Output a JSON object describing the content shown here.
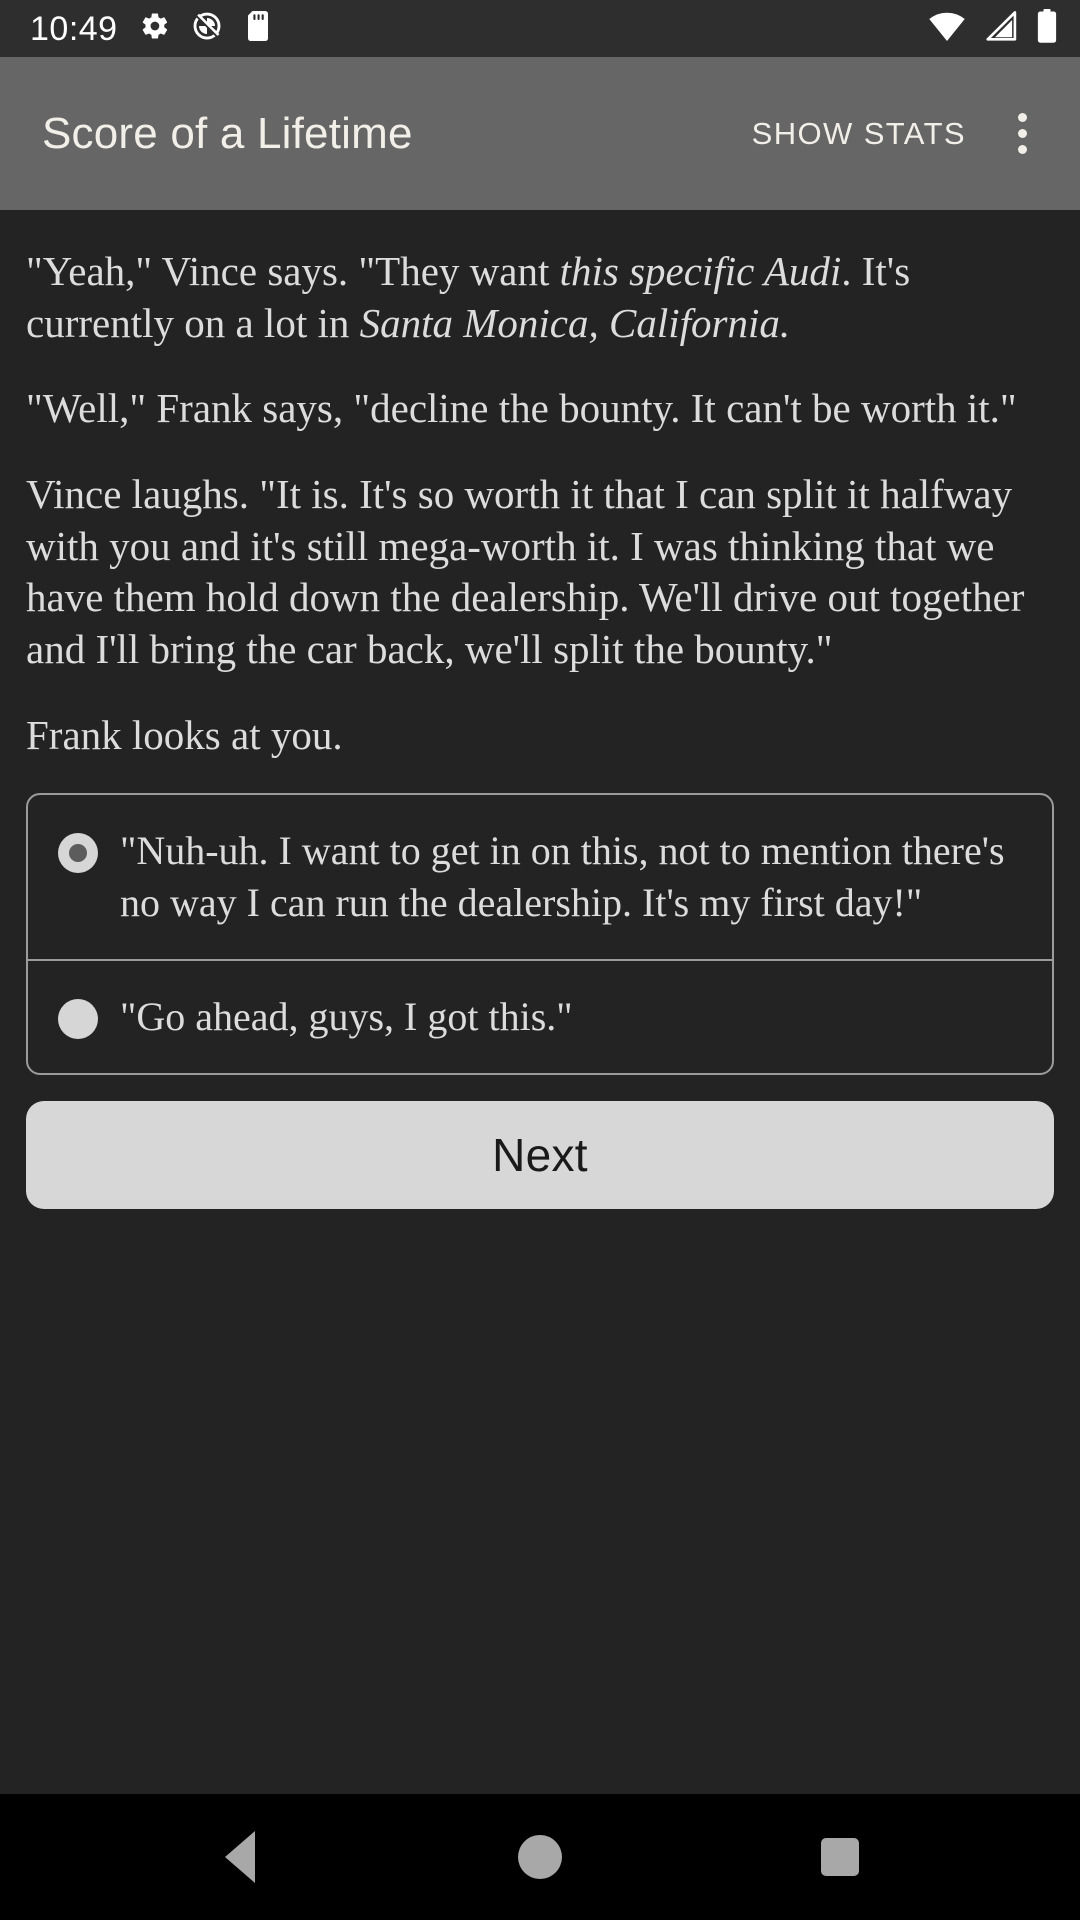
{
  "status_bar": {
    "time": "10:49",
    "left_icons": [
      "gear-icon",
      "do-not-disturb-icon",
      "sd-card-icon"
    ],
    "right_icons": [
      "wifi-icon",
      "cellular-signal-icon",
      "battery-icon"
    ],
    "background_color": "#2e2e2e",
    "foreground_color": "#ffffff"
  },
  "app_bar": {
    "title": "Score of a Lifetime",
    "show_stats_label": "SHOW STATS",
    "overflow_icon": "more-vertical-icon",
    "background_color": "#666666",
    "text_color": "#f2efe9"
  },
  "story": {
    "paragraphs": [
      {
        "runs": [
          {
            "text": "\"Yeah,\" Vince says. \"They want ",
            "italic": false
          },
          {
            "text": "this specific Audi",
            "italic": true
          },
          {
            "text": ". It's currently on a lot in ",
            "italic": false
          },
          {
            "text": "Santa Monica, California.",
            "italic": true
          }
        ]
      },
      {
        "runs": [
          {
            "text": "\"Well,\" Frank says, \"decline the bounty. It can't be worth it.\"",
            "italic": false
          }
        ]
      },
      {
        "runs": [
          {
            "text": "Vince laughs. \"It is. It's so worth it that I can split it halfway with you and it's still mega-worth it. I was thinking that we have them hold down the dealership. We'll drive out together and I'll bring the car back, we'll split the bounty.\"",
            "italic": false
          }
        ]
      },
      {
        "runs": [
          {
            "text": "Frank looks at you.",
            "italic": false
          }
        ]
      }
    ],
    "text_color": "#dcdcdc"
  },
  "choices": {
    "border_color": "#9b9b9b",
    "options": [
      {
        "label": "\"Nuh-uh. I want to get in on this, not to mention there's no way I can run the dealership. It's my first day!\"",
        "selected": true
      },
      {
        "label": "\"Go ahead, guys, I got this.\"",
        "selected": false
      }
    ]
  },
  "next_button": {
    "label": "Next",
    "background_color": "#d7d7d7",
    "text_color": "#1a1a1a"
  },
  "nav_bar": {
    "buttons": [
      "back-icon",
      "home-icon",
      "recents-icon"
    ],
    "background_color": "#000000",
    "icon_color": "#a8a8a8"
  }
}
